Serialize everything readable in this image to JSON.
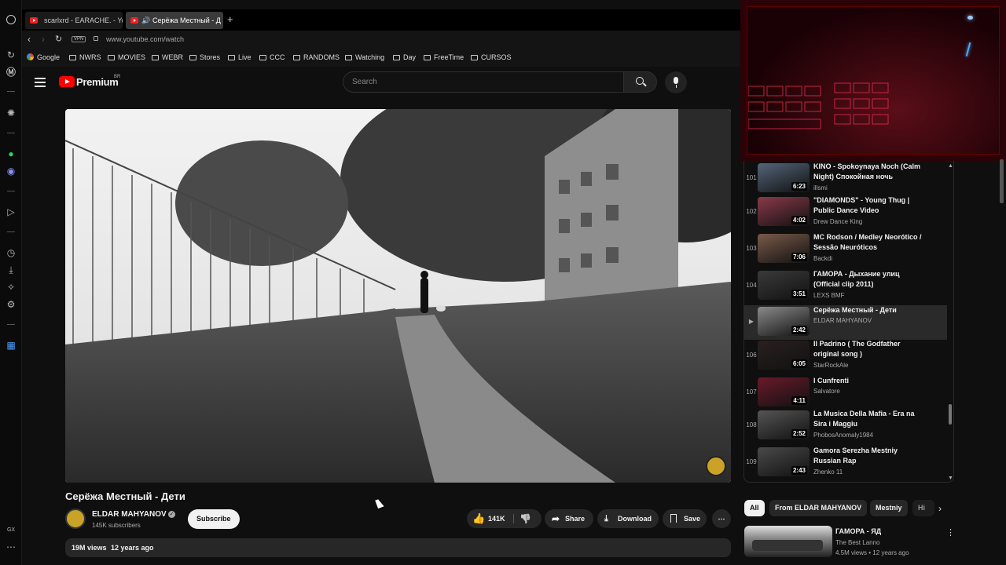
{
  "browser": {
    "tabs": [
      {
        "label": "scarlxrd - EARACHE. - Yo"
      },
      {
        "label": "Серёжа Местный - Д"
      }
    ],
    "vpn_label": "VPN",
    "url": "www.youtube.com/watch",
    "bookmarks": [
      "Google",
      "NWRS",
      "MOVIES",
      "WEBR",
      "Stores",
      "Live",
      "CCC",
      "RANDOMS",
      "Watching",
      "Day",
      "FreeTime",
      "CURSOS"
    ],
    "sidebar_bottom_label": "GX"
  },
  "youtube": {
    "logo_label": "Premium",
    "logo_region": "BR",
    "search_placeholder": "Search",
    "video": {
      "title": "Серёжа Местный - Дети",
      "channel": "ELDAR MAHYANOV",
      "subscribers": "145K subscribers",
      "subscribe_label": "Subscribe",
      "likes": "141K",
      "share_label": "Share",
      "download_label": "Download",
      "save_label": "Save",
      "views": "19M views",
      "age": "12 years ago"
    },
    "playlist": [
      {
        "index": "101",
        "title": "KINO - Spokoynaya Noch (Calm Night) Спокойная ночь",
        "channel": "illsmi",
        "duration": "6:23",
        "thumb": "#55657a"
      },
      {
        "index": "102",
        "title": "\"DIAMONDS\" - Young Thug | Public Dance Video",
        "channel": "Drew Dance King",
        "duration": "4:02",
        "thumb": "#8a3a4a"
      },
      {
        "index": "103",
        "title": "MC Rodson / Medley Neorótico / Sessão Neuróticos",
        "channel": "Backdi",
        "duration": "7:06",
        "thumb": "#7a5a4a"
      },
      {
        "index": "104",
        "title": "ГАМОРА - Дыхание улиц (Official clip 2011)",
        "channel": "LEXS BMF",
        "duration": "3:51",
        "thumb": "#3a3a3a"
      },
      {
        "index": "",
        "title": "Серёжа Местный - Дети",
        "channel": "ELDAR MAHYANOV",
        "duration": "2:42",
        "thumb": "#8a8a8a",
        "active": true
      },
      {
        "index": "106",
        "title": "Il Padrino ( The Godfather original song )",
        "channel": "StarRockAle",
        "duration": "6:05",
        "thumb": "#2a2020"
      },
      {
        "index": "107",
        "title": "I Cunfrenti",
        "channel": "Salvatore",
        "duration": "4:11",
        "thumb": "#6a1a2a"
      },
      {
        "index": "108",
        "title": "La Musica Della Mafia - Era na Sira i Maggiu",
        "channel": "PhobosAnomaly1984",
        "duration": "2:52",
        "thumb": "#555555"
      },
      {
        "index": "109",
        "title": "Gamora Serezha Mestniy Russian Rap",
        "channel": "Zhenko 11",
        "duration": "2:43",
        "thumb": "#4a4a4a"
      }
    ],
    "chips": [
      "All",
      "From ELDAR MAHYANOV",
      "Mestniy",
      "Hi"
    ],
    "recommended": {
      "title": "ГАМОРА - ЯД",
      "channel": "The Best Lanno",
      "meta": "4.5M views • 12 years ago"
    }
  },
  "colors": {
    "accent": "#ff0000",
    "bg": "#0f0f0f",
    "pill": "#272727"
  }
}
